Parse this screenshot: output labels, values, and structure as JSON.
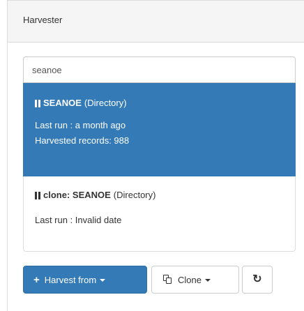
{
  "panel": {
    "title": "Harvester"
  },
  "search": {
    "value": "seanoe"
  },
  "harvesters": [
    {
      "name": "SEANOE",
      "type": "(Directory)",
      "last_run": "Last run : a month ago",
      "records": "Harvested records: 988",
      "selected": true
    },
    {
      "name": "clone: SEANOE",
      "type": "(Directory)",
      "last_run": "Last run : Invalid date",
      "selected": false
    }
  ],
  "buttons": {
    "harvest_from": "Harvest from",
    "clone": "Clone"
  },
  "icons": {
    "status": "pause-icon",
    "harvest": "plus-icon",
    "clone": "copy-icon",
    "refresh": "refresh-icon"
  },
  "colors": {
    "primary": "#337ab7",
    "border": "#dddddd",
    "heading_bg": "#f5f5f5"
  }
}
